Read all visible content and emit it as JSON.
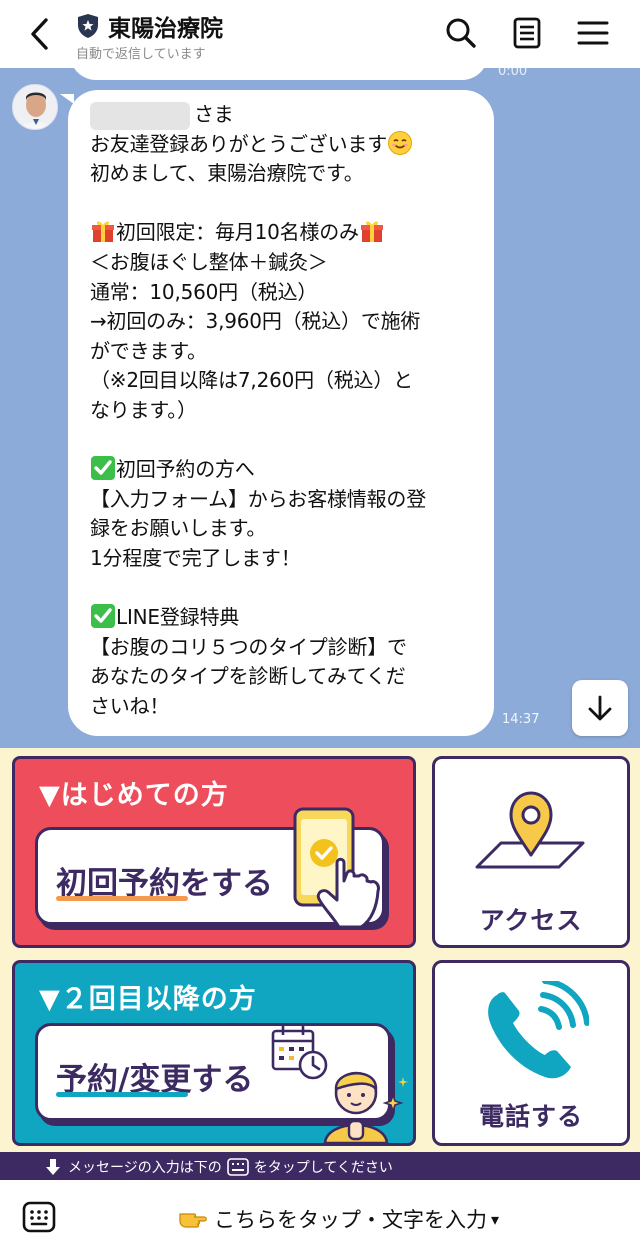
{
  "header": {
    "title": "東陽治療院",
    "subtitle": "自動で返信しています",
    "icons": [
      "back-icon",
      "shield-icon",
      "search-icon",
      "notes-icon",
      "menu-icon"
    ]
  },
  "chat": {
    "prev_time": "0:00",
    "message": {
      "salutation": "さま",
      "lines": [
        "お友達登録ありがとうございます",
        "初めまして、東陽治療院です。",
        "",
        "初回限定：毎月10名様のみ",
        "＜お腹ほぐし整体＋鍼灸＞",
        "通常：10,560円（税込）",
        "→初回のみ：3,960円（税込）で施術",
        "ができます。",
        "（※2回目以降は7,260円（税込）と",
        "なります。）",
        "",
        "初回予約の方へ",
        "【入力フォーム】からお客様情報の登",
        "録をお願いします。",
        "1分程度で完了します！",
        "",
        "LINE登録特典",
        "【お腹のコリ５つのタイプ診断】で",
        "あなたのタイプを診断してみてくだ",
        "さいね！"
      ],
      "time": "14:37"
    }
  },
  "rich_menu": {
    "first_time": {
      "heading": "▼はじめての方",
      "button": "初回予約をする"
    },
    "returning": {
      "heading": "▼２回目以降の方",
      "button": "予約/変更する"
    },
    "access": {
      "label": "アクセス"
    },
    "phone": {
      "label": "電話する"
    }
  },
  "hint": {
    "before": "メッセージの入力は下の",
    "after": "をタップしてください"
  },
  "footer": {
    "label": "こちらをタップ・文字を入力",
    "caret": "▾"
  },
  "colors": {
    "chat_bg": "#8dabd8",
    "menu_bg": "#fcf3cf",
    "red_card": "#ee4d5b",
    "teal_card": "#10a6c2",
    "navy": "#3d2a63"
  }
}
